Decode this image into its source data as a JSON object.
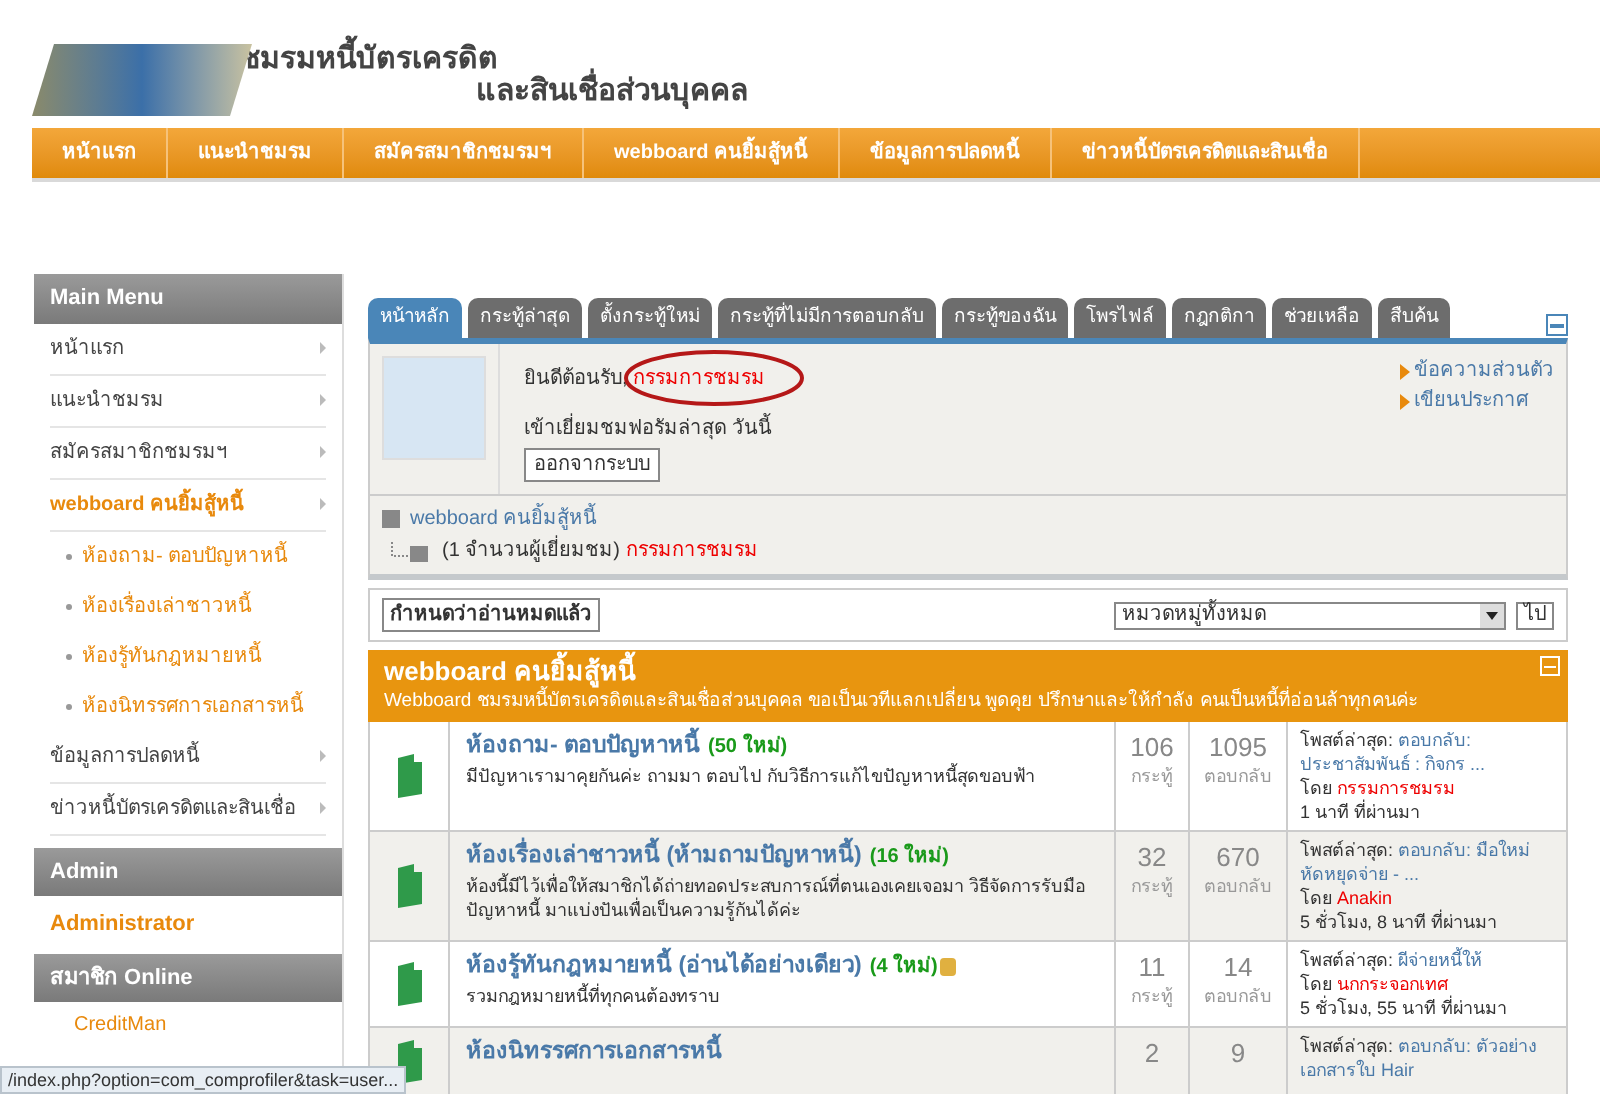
{
  "header": {
    "title_line1": "ชมรมหนี้บัตรเครดิต",
    "title_line2": "และสินเชื่อส่วนบุคคล"
  },
  "nav": [
    "หน้าแรก",
    "แนะนำชมรม",
    "สมัครสมาชิกชมรมฯ",
    "webboard คนยิ้มสู้หนี้",
    "ข้อมูลการปลดหนี้",
    "ข่าวหนี้บัตรเครดิตและสินเชื่อ"
  ],
  "sidebar": {
    "main_menu": {
      "title": "Main Menu",
      "items": [
        {
          "label": "หน้าแรก",
          "kind": "menu",
          "selected": false
        },
        {
          "label": "แนะนำชมรม",
          "kind": "menu",
          "selected": false
        },
        {
          "label": "สมัครสมาชิกชมรมฯ",
          "kind": "menu",
          "selected": false
        },
        {
          "label": "webboard คนยิ้มสู้หนี้",
          "kind": "menu",
          "selected": true
        },
        {
          "label": "ห้องถาม- ตอบปัญหาหนี้",
          "kind": "sub",
          "selected": false
        },
        {
          "label": "ห้องเรื่องเล่าชาวหนี้",
          "kind": "sub",
          "selected": false
        },
        {
          "label": "ห้องรู้ทันกฎหมายหนี้",
          "kind": "sub",
          "selected": false
        },
        {
          "label": "ห้องนิทรรศการเอกสารหนี้",
          "kind": "sub",
          "selected": false
        },
        {
          "label": "ข้อมูลการปลดหนี้",
          "kind": "menu",
          "selected": false
        },
        {
          "label": "ข่าวหนี้บัตรเครดิตและสินเชื่อ",
          "kind": "menu",
          "selected": false
        }
      ]
    },
    "admin": {
      "title": "Admin",
      "link": "Administrator"
    },
    "online": {
      "title": "สมาชิก Online",
      "members": [
        "CreditMan"
      ]
    }
  },
  "tabs": [
    {
      "label": "หน้าหลัก",
      "selected": true
    },
    {
      "label": "กระทู้ล่าสุด",
      "selected": false
    },
    {
      "label": "ตั้งกระทู้ใหม่",
      "selected": false
    },
    {
      "label": "กระทู้ที่ไม่มีการตอบกลับ",
      "selected": false
    },
    {
      "label": "กระทู้ของฉัน",
      "selected": false
    },
    {
      "label": "โพรไฟล์",
      "selected": false
    },
    {
      "label": "กฎกติกา",
      "selected": false
    },
    {
      "label": "ช่วยเหลือ",
      "selected": false
    },
    {
      "label": "สืบค้น",
      "selected": false
    }
  ],
  "user_panel": {
    "welcome": "ยินดีต้อนรับ,",
    "username": "กรรมการชมรม",
    "last_visit": "เข้าเยี่ยมชมฟอรัมล่าสุด วันนี้",
    "logout": "ออกจากระบบ",
    "links": [
      "ข้อความส่วนตัว",
      "เขียนประกาศ"
    ]
  },
  "who_online": {
    "board": "webboard คนยิ้มสู้หนี้",
    "count": "(1 จำนวนผู้เยี่ยมชม)",
    "user": "กรรมการชมรม"
  },
  "toolbar": {
    "mark_read": "กำหนดว่าอ่านหมดแล้ว",
    "category": "หมวดหมู่ทั้งหมด",
    "go": "ไป"
  },
  "forum": {
    "title": "webboard คนยิ้มสู้หนี้",
    "description": "Webboard ชมรมหนี้บัตรเครดิตและสินเชื่อส่วนบุคคล ขอเป็นเวทีแลกเปลี่ยน พูดคุย ปรึกษาและให้กำลัง คนเป็นหนี้ที่อ่อนล้าทุกคนค่ะ",
    "rows": [
      {
        "title": "ห้องถาม- ตอบปัญหาหนี้",
        "new": "(50 ใหม่)",
        "locked": false,
        "description": "มีปัญหาเรามาคุยกันค่ะ ถามมา ตอบไป กับวิธีการแก้ไขปัญหาหนี้สุดขอบฟ้า",
        "topics": "106",
        "topics_label": "กระทู้",
        "replies": "1095",
        "replies_label": "ตอบกลับ",
        "last_label": "โพสต์ล่าสุด:",
        "last_post": "ตอบกลับ: ประชาสัมพันธ์ : กิจกร ...",
        "by_label": "โดย",
        "author": "กรรมการชมรม",
        "time": "1 นาที ที่ผ่านมา"
      },
      {
        "title": "ห้องเรื่องเล่าชาวหนี้ (ห้ามถามปัญหาหนี้)",
        "new": "(16 ใหม่)",
        "locked": false,
        "description": "ห้องนี้มีไว้เพื่อให้สมาชิกได้ถ่ายทอดประสบการณ์ที่ตนเองเคยเจอมา วิธีจัดการรับมือปัญหาหนี้ มาแบ่งปันเพื่อเป็นความรู้กันได้ค่ะ",
        "topics": "32",
        "topics_label": "กระทู้",
        "replies": "670",
        "replies_label": "ตอบกลับ",
        "last_label": "โพสต์ล่าสุด:",
        "last_post": "ตอบกลับ: มือใหม่หัดหยุดจ่าย - ...",
        "by_label": "โดย",
        "author": "Anakin",
        "time": "5 ชั่วโมง, 8 นาที ที่ผ่านมา"
      },
      {
        "title": "ห้องรู้ทันกฎหมายหนี้ (อ่านได้อย่างเดียว)",
        "new": "(4 ใหม่)",
        "locked": true,
        "description": "รวมกฎหมายหนี้ที่ทุกคนต้องทราบ",
        "topics": "11",
        "topics_label": "กระทู้",
        "replies": "14",
        "replies_label": "ตอบกลับ",
        "last_label": "โพสต์ล่าสุด:",
        "last_post": "ผีจ่ายหนี้ให้",
        "by_label": "โดย",
        "author": "นกกระจอกเทศ",
        "time": "5 ชั่วโมง, 55 นาที ที่ผ่านมา"
      },
      {
        "title": "ห้องนิทรรศการเอกสารหนี้",
        "locked": false,
        "topics": "2",
        "replies": "9",
        "last_label": "โพสต์ล่าสุด:",
        "last_post": "ตอบกลับ: ตัวอย่าง เอกสารใบ Hair"
      }
    ]
  },
  "status_bar": "/index.php?option=com_comprofiler&task=user..."
}
